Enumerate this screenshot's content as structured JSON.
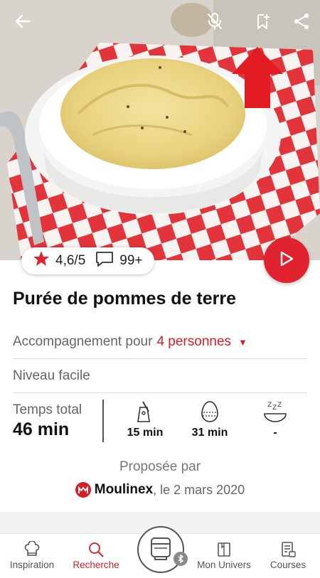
{
  "recipe": {
    "rating": "4,6/5",
    "comments": "99+",
    "title": "Purée de pommes de terre",
    "serving_prefix": "Accompagnement pour",
    "serving_value": "4 personnes",
    "level": "Niveau facile",
    "total_time_label": "Temps total",
    "total_time_value": "46 min",
    "prep_time": "15 min",
    "cook_time": "31 min",
    "rest_time": "-",
    "proposed_by": "Proposée par",
    "brand": "Moulinex",
    "date": ", le 2 mars 2020"
  },
  "icons": {
    "back": "arrow-left-icon",
    "voice": "microphone-off-icon",
    "bookmark": "bookmark-add-icon",
    "share": "share-icon",
    "play": "play-icon",
    "star": "star-icon",
    "comment": "comment-icon"
  },
  "nav": {
    "items": [
      {
        "label": "Inspiration"
      },
      {
        "label": "Recherche"
      },
      {
        "label": "Mon Univers"
      },
      {
        "label": "Courses"
      }
    ]
  },
  "colors": {
    "accent": "#d42028",
    "star": "#e0232f"
  }
}
